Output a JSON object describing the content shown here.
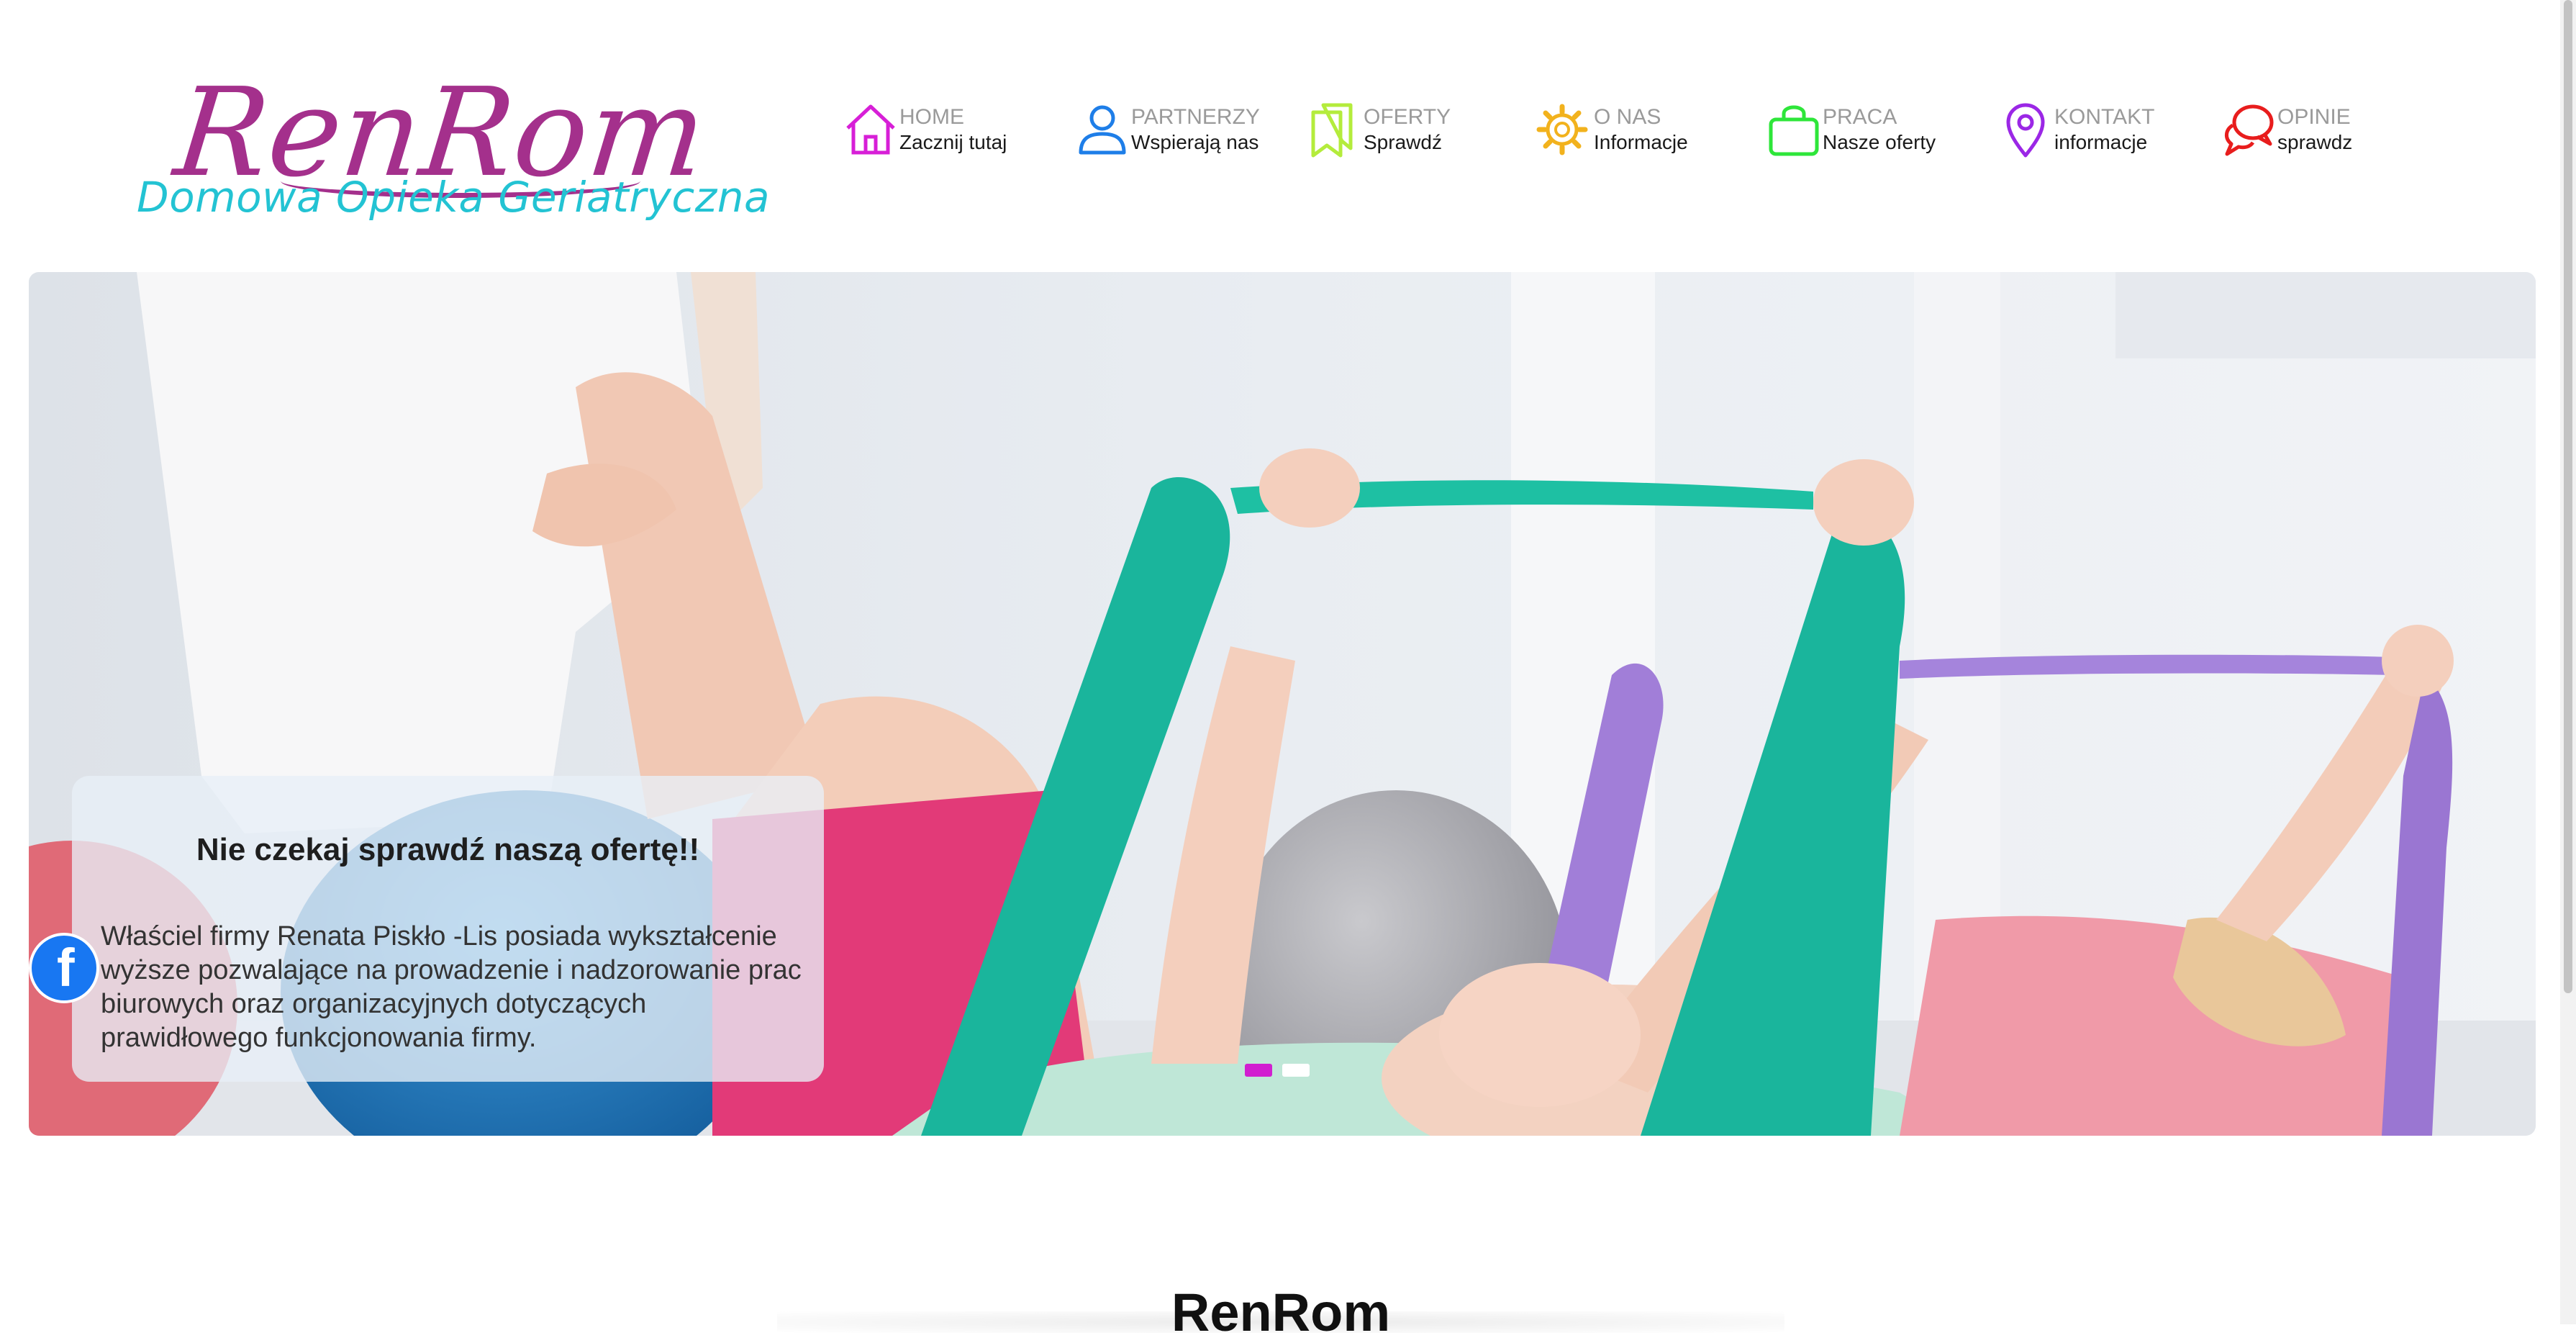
{
  "logo": {
    "main": "RenRom",
    "sub": "Domowa Opieka Geriatryczna"
  },
  "nav": [
    {
      "title": "HOME",
      "sub": "Zacznij tutaj",
      "icon": "home-icon",
      "color": "#d71fd7"
    },
    {
      "title": "PARTNERZY",
      "sub": "Wspierają nas",
      "icon": "user-icon",
      "color": "#1e7ee8"
    },
    {
      "title": "OFERTY",
      "sub": "Sprawdź",
      "icon": "bookmarks-icon",
      "color": "#b4ec3c"
    },
    {
      "title": "O NAS",
      "sub": "Informacje",
      "icon": "gear-icon",
      "color": "#f2b21d"
    },
    {
      "title": "PRACA",
      "sub": "Nasze oferty",
      "icon": "shopping-bag-icon",
      "color": "#2ee63a"
    },
    {
      "title": "KONTAKT",
      "sub": "informacje",
      "icon": "map-pin-icon",
      "color": "#9b27e6"
    },
    {
      "title": "OPINIE",
      "sub": "sprawdz",
      "icon": "chat-bubbles-icon",
      "color": "#e81d1d"
    }
  ],
  "slider": {
    "caption_title": "Nie czekaj sprawdź naszą ofertę!!",
    "caption_text": "Właściel firmy Renata Piskło -Lis posiada wykształcenie wyższe pozwalające na prowadzenie i nadzorowanie prac biurowych oraz organizacyjnych dotyczących prawidłowego funkcjonowania firmy.",
    "dots": [
      {
        "active": true,
        "color": "#d11fd0"
      },
      {
        "active": false,
        "color": "#ffffff"
      }
    ]
  },
  "social": {
    "facebook_label": "f",
    "icon": "facebook-icon",
    "color": "#1877f2"
  },
  "section": {
    "title": "RenRom"
  }
}
